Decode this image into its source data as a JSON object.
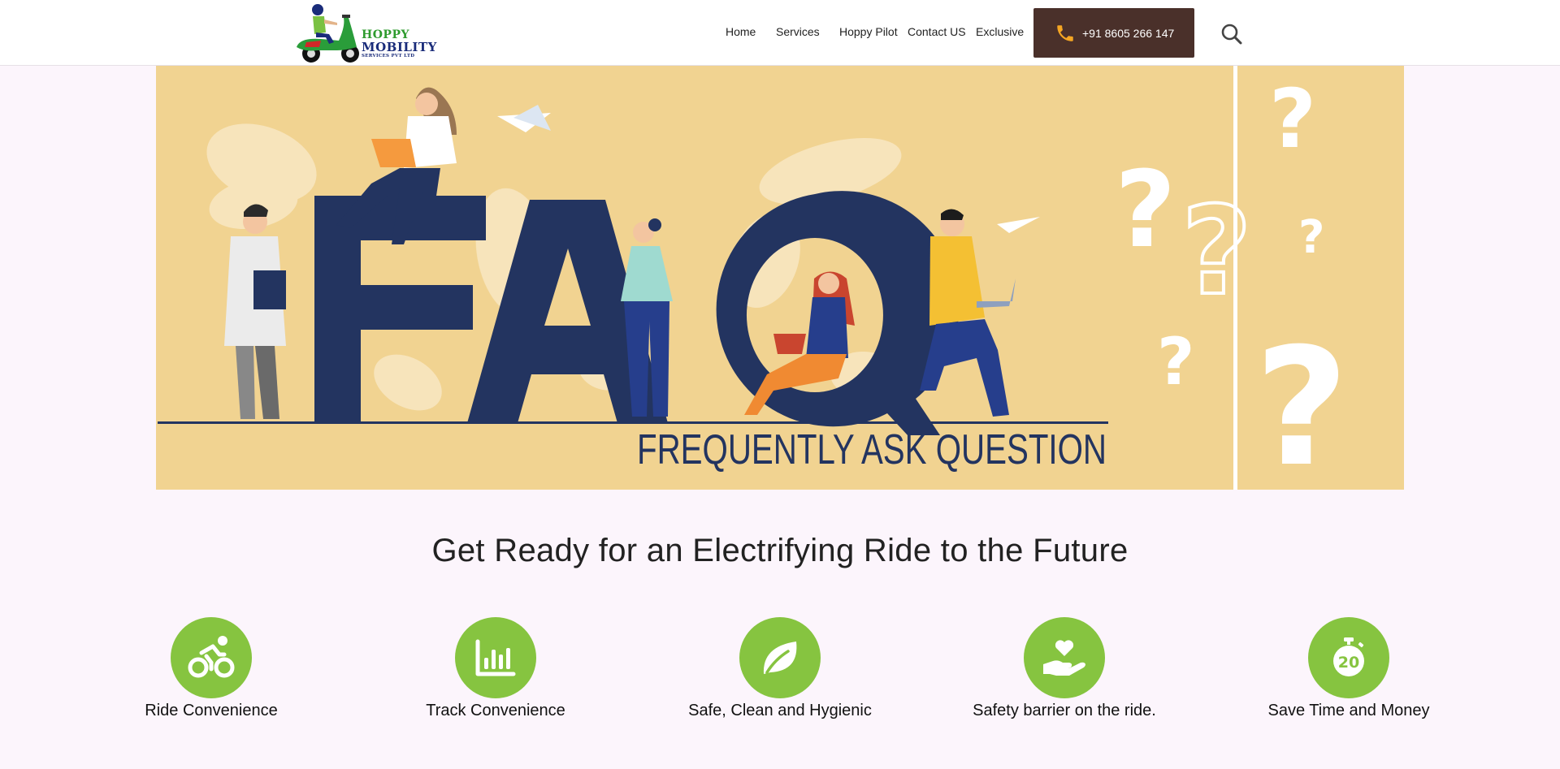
{
  "header": {
    "logo": {
      "line1": "HOPPY",
      "line2": "MOBILITY",
      "line3": "SERVICES PVT LTD"
    },
    "nav": [
      "Home",
      "Services",
      "Hoppy Pilot",
      "Contact US",
      "Exclusive"
    ],
    "phone": {
      "label": "+91 8605 266 147",
      "icon": "phone-icon"
    },
    "search_icon": "search-icon"
  },
  "hero": {
    "headline": "FAQ",
    "subtitle": "FREQUENTLY ASK QUESTION",
    "colors": {
      "background": "#f1d391",
      "letters": "#233460"
    }
  },
  "tagline": "Get Ready for an Electrifying Ride to the Future",
  "features": [
    {
      "label": "Ride Convenience",
      "icon": "bicycle-icon"
    },
    {
      "label": "Track Convenience",
      "icon": "bar-chart-icon"
    },
    {
      "label": "Safe, Clean and Hygienic",
      "icon": "leaf-icon"
    },
    {
      "label": "Safety barrier on the ride.",
      "icon": "heart-hand-icon"
    },
    {
      "label": "Save Time and Money",
      "icon": "stopwatch-20-icon"
    }
  ],
  "colors": {
    "accent_green": "#86c440",
    "phone_button": "#4a302a",
    "page_background": "#fcf5fc"
  }
}
